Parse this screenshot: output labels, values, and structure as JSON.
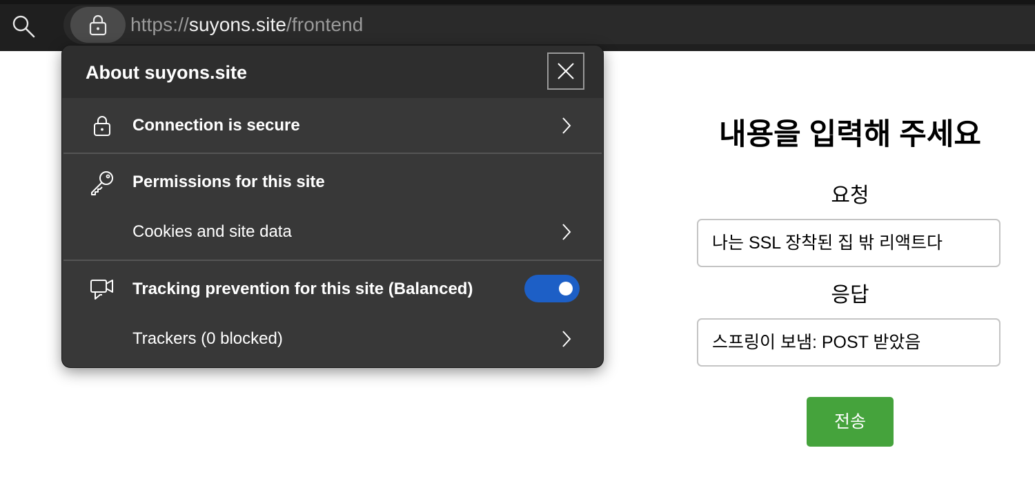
{
  "browser": {
    "url_scheme": "https://",
    "url_host": "suyons.site",
    "url_path": "/frontend"
  },
  "site_info": {
    "title": "About suyons.site",
    "rows": [
      {
        "label": "Connection is secure",
        "icon": "lock-icon",
        "chevron": true
      },
      {
        "label": "Permissions for this site",
        "icon": "key-icon",
        "chevron": false
      },
      {
        "label": "Cookies and site data",
        "icon": null,
        "chevron": true
      },
      {
        "label": "Tracking prevention for this site (Balanced)",
        "icon": "tracking-icon",
        "toggle_on": true
      },
      {
        "label": "Trackers (0 blocked)",
        "icon": null,
        "chevron": true
      }
    ]
  },
  "page": {
    "title": "내용을 입력해 주세요",
    "request_label": "요청",
    "request_value": "나는 SSL 장착된 집 밖 리액트다",
    "response_label": "응답",
    "response_value": "스프링이 보냄: POST 받았음",
    "submit_label": "전송"
  },
  "colors": {
    "toolbar_bg": "#1f1f1f",
    "popup_bg": "#383838",
    "toggle_on": "#1d5fc6",
    "submit_button": "#45a33c"
  }
}
